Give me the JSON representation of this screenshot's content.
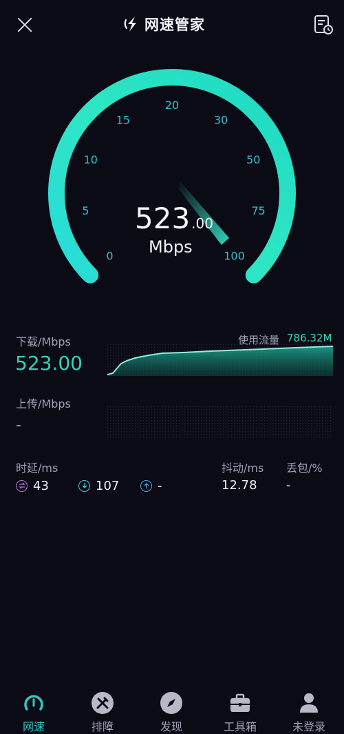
{
  "header": {
    "title": "网速管家",
    "close_icon": "close-icon",
    "history_icon": "history-report-icon"
  },
  "gauge": {
    "ticks": [
      "0",
      "5",
      "10",
      "15",
      "20",
      "30",
      "50",
      "75",
      "100"
    ],
    "speed_int": "523",
    "speed_dec": ".00",
    "unit": "Mbps",
    "arc_color_start": "#2ee6c3",
    "arc_color_end": "#19c6de",
    "fill_fraction": 1.0
  },
  "download": {
    "label": "下载/Mbps",
    "value": "523.00",
    "usage_label": "使用流量",
    "usage_value": "786.32M"
  },
  "upload": {
    "label": "上传/Mbps",
    "value": "-"
  },
  "latency": {
    "label": "时延/ms",
    "idle": "43",
    "down": "107",
    "up": "-",
    "jitter_label": "抖动/ms",
    "jitter": "12.78",
    "loss_label": "丢包/%",
    "loss": "-"
  },
  "nav": {
    "items": [
      {
        "label": "网速",
        "icon": "speedometer-icon"
      },
      {
        "label": "排障",
        "icon": "tools-icon"
      },
      {
        "label": "发现",
        "icon": "compass-icon"
      },
      {
        "label": "工具箱",
        "icon": "toolbox-icon"
      },
      {
        "label": "未登录",
        "icon": "user-icon"
      }
    ]
  },
  "colors": {
    "accent": "#34d1b4",
    "background": "#0b0b16",
    "text_muted": "#9ea3b5"
  }
}
